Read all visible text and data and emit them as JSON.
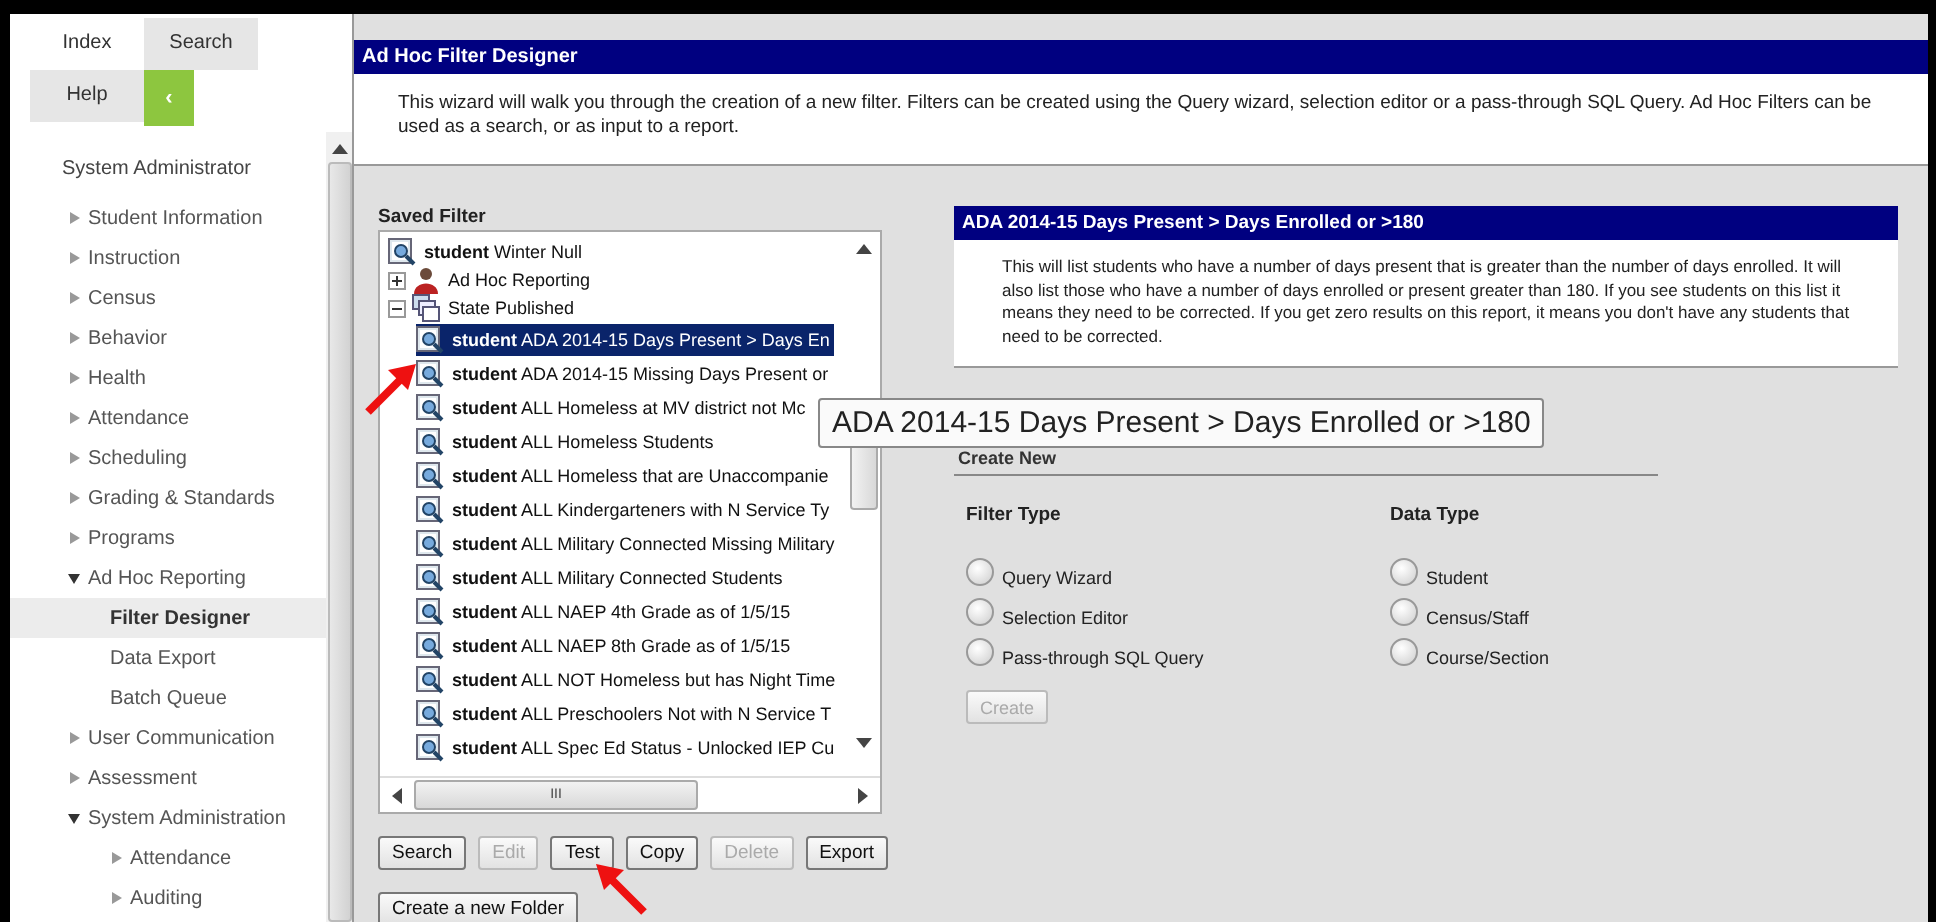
{
  "sidebar": {
    "tabs": [
      {
        "label": "Index",
        "selected": true
      },
      {
        "label": "Search",
        "selected": false
      },
      {
        "label": "Help",
        "selected": false
      }
    ],
    "collapse_button": "‹",
    "heading": "System Administrator",
    "items": [
      {
        "label": "Student Information",
        "kind": "group",
        "expanded": false,
        "selected": false
      },
      {
        "label": "Instruction",
        "kind": "group",
        "expanded": false,
        "selected": false
      },
      {
        "label": "Census",
        "kind": "group",
        "expanded": false,
        "selected": false
      },
      {
        "label": "Behavior",
        "kind": "group",
        "expanded": false,
        "selected": false
      },
      {
        "label": "Health",
        "kind": "group",
        "expanded": false,
        "selected": false
      },
      {
        "label": "Attendance",
        "kind": "group",
        "expanded": false,
        "selected": false
      },
      {
        "label": "Scheduling",
        "kind": "group",
        "expanded": false,
        "selected": false
      },
      {
        "label": "Grading & Standards",
        "kind": "group",
        "expanded": false,
        "selected": false
      },
      {
        "label": "Programs",
        "kind": "group",
        "expanded": false,
        "selected": false
      },
      {
        "label": "Ad Hoc Reporting",
        "kind": "group",
        "expanded": true,
        "selected": false,
        "children": [
          {
            "label": "Filter Designer",
            "kind": "page",
            "selected": true
          },
          {
            "label": "Data Export",
            "kind": "page",
            "selected": false
          },
          {
            "label": "Batch Queue",
            "kind": "page",
            "selected": false
          }
        ]
      },
      {
        "label": "User Communication",
        "kind": "group",
        "expanded": false,
        "selected": false
      },
      {
        "label": "Assessment",
        "kind": "group",
        "expanded": false,
        "selected": false
      },
      {
        "label": "System Administration",
        "kind": "group",
        "expanded": true,
        "selected": false,
        "children": [
          {
            "label": "Attendance",
            "kind": "group",
            "expanded": false,
            "selected": false
          },
          {
            "label": "Auditing",
            "kind": "group",
            "expanded": false,
            "selected": false
          }
        ]
      }
    ]
  },
  "main": {
    "title": "Ad Hoc Filter Designer",
    "intro": "This wizard will walk you through the creation of a new filter. Filters can be created using the Query wizard, selection editor or a pass-through SQL Query. Ad Hoc Filters can be used as a search, or as input to a report.",
    "saved_filter": {
      "label": "Saved Filter",
      "tree": [
        {
          "kind": "filter",
          "label": "**student** Winter Null",
          "selected": false
        },
        {
          "kind": "user-folder",
          "label": "Ad Hoc Reporting",
          "expanded": false
        },
        {
          "kind": "folder",
          "label": "State Published",
          "expanded": true,
          "children": [
            {
              "kind": "filter",
              "label": "**student** ADA 2014-15 Days Present > Days En",
              "selected": true
            },
            {
              "kind": "filter",
              "label": "**student** ADA 2014-15 Missing Days Present or",
              "selected": false
            },
            {
              "kind": "filter",
              "label": "**student** ALL Homeless at MV district not Mc",
              "selected": false
            },
            {
              "kind": "filter",
              "label": "**student** ALL Homeless Students",
              "selected": false
            },
            {
              "kind": "filter",
              "label": "**student** ALL Homeless that are Unaccompanie",
              "selected": false
            },
            {
              "kind": "filter",
              "label": "**student** ALL Kindergarteners with N Service Ty",
              "selected": false
            },
            {
              "kind": "filter",
              "label": "**student** ALL Military Connected Missing Military",
              "selected": false
            },
            {
              "kind": "filter",
              "label": "**student** ALL Military Connected Students",
              "selected": false
            },
            {
              "kind": "filter",
              "label": "**student** ALL NAEP 4th Grade as of 1/5/15",
              "selected": false
            },
            {
              "kind": "filter",
              "label": "**student** ALL NAEP 8th Grade as of 1/5/15",
              "selected": false
            },
            {
              "kind": "filter",
              "label": "**student** ALL NOT Homeless but has Night Time",
              "selected": false
            },
            {
              "kind": "filter",
              "label": "**student** ALL Preschoolers Not with N Service T",
              "selected": false
            },
            {
              "kind": "filter",
              "label": "**student** ALL Spec Ed Status - Unlocked IEP Cu",
              "selected": false
            }
          ]
        }
      ],
      "scroll_thumb": "III",
      "buttons": [
        {
          "label": "Search",
          "disabled": false,
          "highlighted": false
        },
        {
          "label": "Edit",
          "disabled": true,
          "highlighted": false
        },
        {
          "label": "Test",
          "disabled": false,
          "highlighted": true
        },
        {
          "label": "Copy",
          "disabled": false,
          "highlighted": false
        },
        {
          "label": "Delete",
          "disabled": true,
          "highlighted": false
        },
        {
          "label": "Export",
          "disabled": false,
          "highlighted": false
        }
      ],
      "folder_button": "Create a new Folder"
    },
    "detail": {
      "title": "ADA 2014-15 Days Present > Days Enrolled or >180",
      "description": "This will list students who have a number of days present that is greater than the number of days enrolled.  It will also list those who have a number of days enrolled or present greater than 180. If you see students on this list it means they need to be corrected.  If you get zero results on this report, it means you don't have any students that need to be corrected."
    },
    "tooltip": "ADA 2014-15 Days Present > Days Enrolled or >180",
    "create_new": {
      "heading": "Create New",
      "filter_type": {
        "label": "Filter Type",
        "options": [
          {
            "label": "Query Wizard",
            "selected": false
          },
          {
            "label": "Selection Editor",
            "selected": false
          },
          {
            "label": "Pass-through SQL Query",
            "selected": false
          }
        ]
      },
      "data_type": {
        "label": "Data Type",
        "options": [
          {
            "label": "Student",
            "selected": false
          },
          {
            "label": "Census/Staff",
            "selected": false
          },
          {
            "label": "Course/Section",
            "selected": false
          }
        ]
      },
      "button": {
        "label": "Create",
        "disabled": true
      }
    }
  }
}
